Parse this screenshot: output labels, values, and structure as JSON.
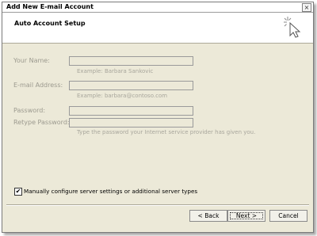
{
  "window": {
    "title": "Add New E-mail Account",
    "close_glyph": "×"
  },
  "header": {
    "title": "Auto Account Setup",
    "icon": "mouse-cursor-sparkle-icon"
  },
  "form": {
    "your_name": {
      "label": "Your Name:",
      "value": "",
      "example": "Example: Barbara Sankovic"
    },
    "email": {
      "label": "E-mail Address:",
      "value": "",
      "example": "Example: barbara@contoso.com"
    },
    "password": {
      "label": "Password:",
      "value": ""
    },
    "retype_password": {
      "label": "Retype Password:",
      "value": "",
      "hint": "Type the password your Internet service provider has given you."
    }
  },
  "manual_config": {
    "label": "Manually configure server settings or additional server types",
    "checked": true,
    "check_glyph": "✔"
  },
  "buttons": {
    "back": "< Back",
    "next": "Next >",
    "cancel": "Cancel"
  }
}
